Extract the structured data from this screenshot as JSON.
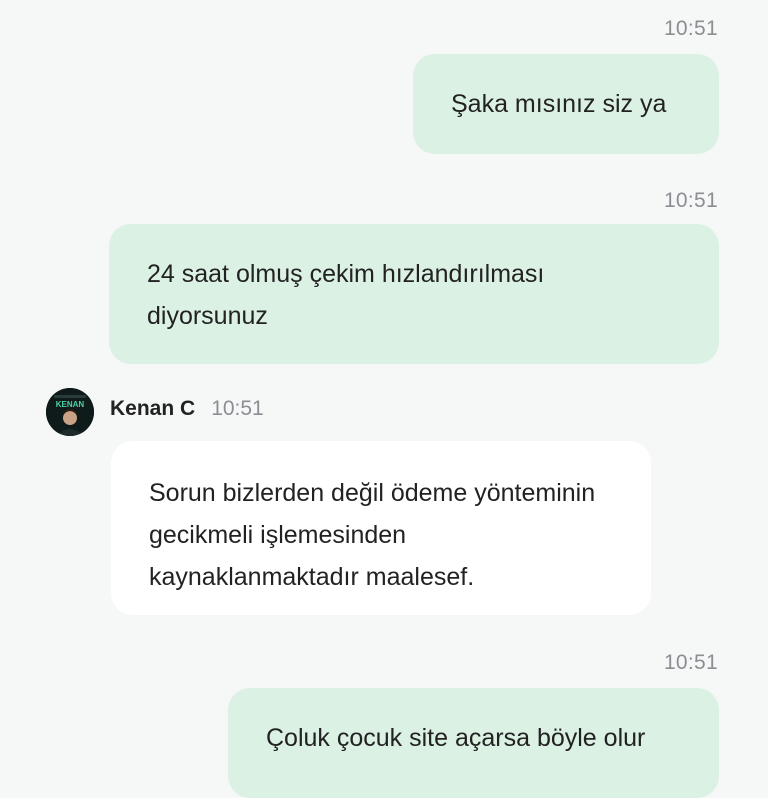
{
  "messages": [
    {
      "time": "10:51",
      "text": "Şaka mısınız siz ya"
    },
    {
      "time": "10:51",
      "text": "24 saat olmuş çekim hızlandırılması diyorsunuz"
    },
    {
      "sender": "Kenan C",
      "time": "10:51",
      "text": "Sorun bizlerden değil ödeme yönteminin gecikmeli işlemesinden kaynaklanmaktadır maalesef."
    },
    {
      "time": "10:51",
      "text": "Çoluk çocuk site açarsa böyle olur"
    }
  ],
  "avatar": {
    "label": "KENAN",
    "colors": {
      "bg": "#0f1a1a",
      "accent": "#4fd1a5"
    }
  },
  "colors": {
    "outgoing": "#dbf1e4",
    "incoming": "#ffffff",
    "background": "#f6f7f7",
    "timestamp": "#8a8f93"
  }
}
